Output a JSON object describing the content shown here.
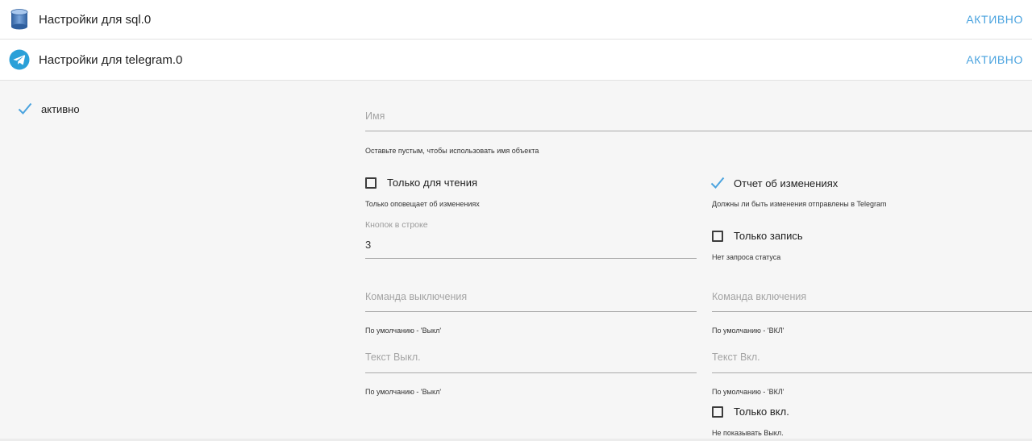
{
  "adapters": [
    {
      "title": "Настройки для sql.0",
      "status": "АКТИВНО",
      "icon": "database-icon"
    },
    {
      "title": "Настройки для telegram.0",
      "status": "АКТИВНО",
      "icon": "telegram-icon"
    }
  ],
  "colors": {
    "accent": "#4aa3df",
    "panel_bg": "#f6f6f6",
    "row_bg": "#ffffff"
  },
  "settings": {
    "active_label": "активно",
    "name": {
      "placeholder": "Имя",
      "hint": "Оставьте пустым, чтобы использовать имя объекта"
    },
    "readonly": {
      "label": "Только для чтения",
      "checked": false,
      "hint": "Только оповещает об изменениях"
    },
    "report": {
      "label": "Отчет об изменениях",
      "checked": true,
      "hint": "Должны ли быть изменения отправлены в Telegram"
    },
    "buttons_per_row": {
      "label": "Кнопок в строке",
      "value": "3"
    },
    "write_only": {
      "label": "Только запись",
      "checked": false,
      "hint": "Нет запроса статуса"
    },
    "off_command": {
      "placeholder": "Команда выключения",
      "hint": "По умолчанию - 'Выкл'"
    },
    "on_command": {
      "placeholder": "Команда включения",
      "hint": "По умолчанию - 'ВКЛ'"
    },
    "off_text": {
      "placeholder": "Текст Выкл.",
      "hint": "По умолчанию - 'Выкл'"
    },
    "on_text": {
      "placeholder": "Текст Вкл.",
      "hint": "По умолчанию - 'ВКЛ'"
    },
    "only_on": {
      "label": "Только вкл.",
      "checked": false,
      "hint": "Не показывать Выкл."
    }
  }
}
